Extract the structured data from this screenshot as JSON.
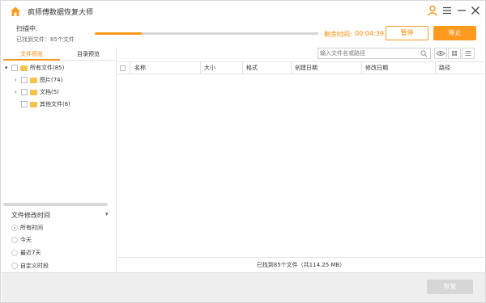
{
  "app": {
    "title": "疯师傅数据恢复大师"
  },
  "scan": {
    "status": "扫描中.",
    "found": "已找到文件：85个文件",
    "progress": 0.21,
    "remain_label": "剩余时间:",
    "remain_time": "00:04:39",
    "pause_label": "暂停",
    "stop_label": "停止"
  },
  "left_tabs": [
    "文件预览",
    "目录预览"
  ],
  "tree": {
    "root": "所有文件(85)",
    "children": [
      "图片(74)",
      "文档(5)",
      "其他文件(6)"
    ]
  },
  "filter": {
    "title": "文件修改时间",
    "options": [
      "所有时间",
      "今天",
      "最近7天",
      "自定义时段"
    ],
    "selected": "所有时间"
  },
  "search": {
    "placeholder": "输入文件名或路径"
  },
  "columns": [
    "名称",
    "大小",
    "格式",
    "创建日期",
    "修改日期",
    "路径"
  ],
  "summary": "已找到85个文件（共114.25 MB）",
  "footer": {
    "recover_label": "恢复"
  },
  "colors": {
    "accent": "#ff9a1f",
    "folder": "#f5c34a"
  }
}
